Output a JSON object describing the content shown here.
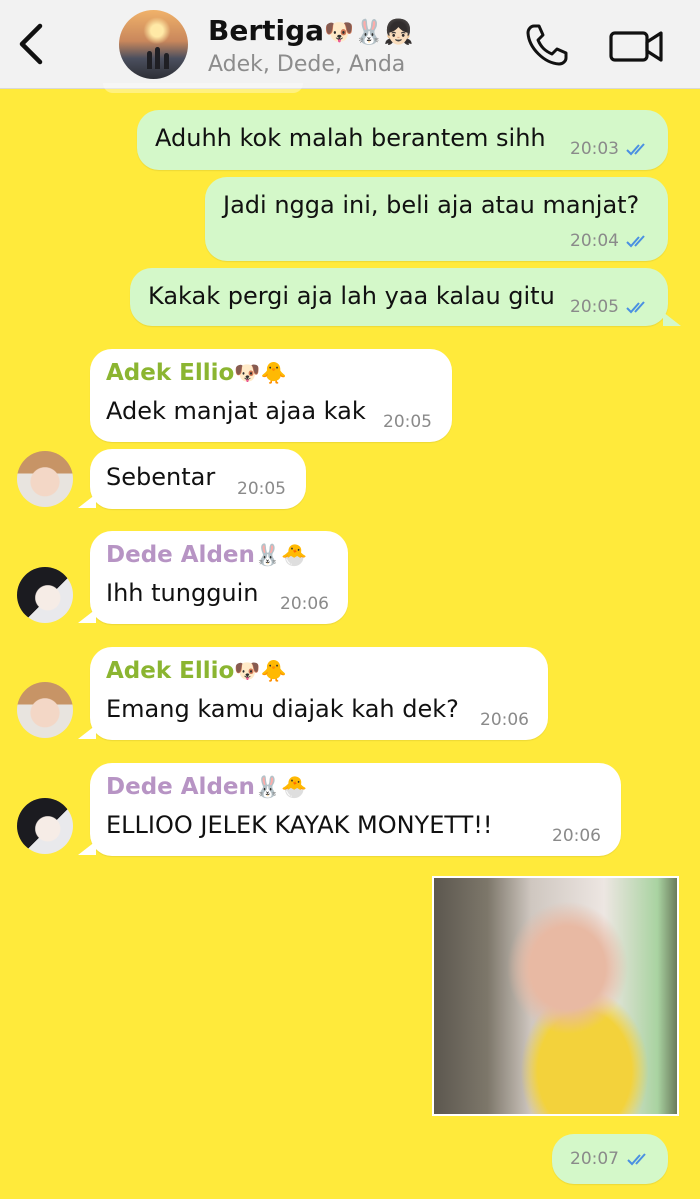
{
  "header": {
    "back_icon": "chevron-left-icon",
    "title": "Bertiga",
    "title_emoji": "🐶🐰👧🏻",
    "subtitle": "Adek, Dede, Anda",
    "call_icon": "phone-icon",
    "video_icon": "video-camera-icon"
  },
  "colors": {
    "background": "#FFEA3B",
    "outgoing_bubble": "#D4F8C9",
    "incoming_bubble": "#FFFFFF",
    "sender_adek": "#8BB531",
    "sender_dede": "#B794C4",
    "read_ticks": "#4A90E2"
  },
  "messages": [
    {
      "direction": "out",
      "text": "Aduhh kok malah berantem sihh",
      "time": "20:03",
      "status": "read"
    },
    {
      "direction": "out",
      "text": "Jadi ngga ini, beli aja atau manjat?",
      "time": "20:04",
      "status": "read"
    },
    {
      "direction": "out",
      "text": "Kakak pergi aja lah yaa kalau gitu",
      "time": "20:05",
      "status": "read"
    },
    {
      "direction": "in",
      "sender": "Adek Ellio",
      "sender_emoji": "🐶🐥",
      "text": "Adek manjat ajaa kak",
      "time": "20:05"
    },
    {
      "direction": "in",
      "text": "Sebentar",
      "time": "20:05"
    },
    {
      "direction": "in",
      "sender": "Dede Alden",
      "sender_emoji": "🐰🐣",
      "text": "Ihh tungguin",
      "time": "20:06"
    },
    {
      "direction": "in",
      "sender": "Adek Ellio",
      "sender_emoji": "🐶🐥",
      "text": "Emang kamu diajak kah dek?",
      "time": "20:06"
    },
    {
      "direction": "in",
      "sender": "Dede Alden",
      "sender_emoji": "🐰🐣",
      "text": "ELLIOO JELEK KAYAK MONYETT!!",
      "time": "20:06"
    },
    {
      "direction": "out",
      "type": "image",
      "time": "20:07",
      "status": "read"
    }
  ]
}
